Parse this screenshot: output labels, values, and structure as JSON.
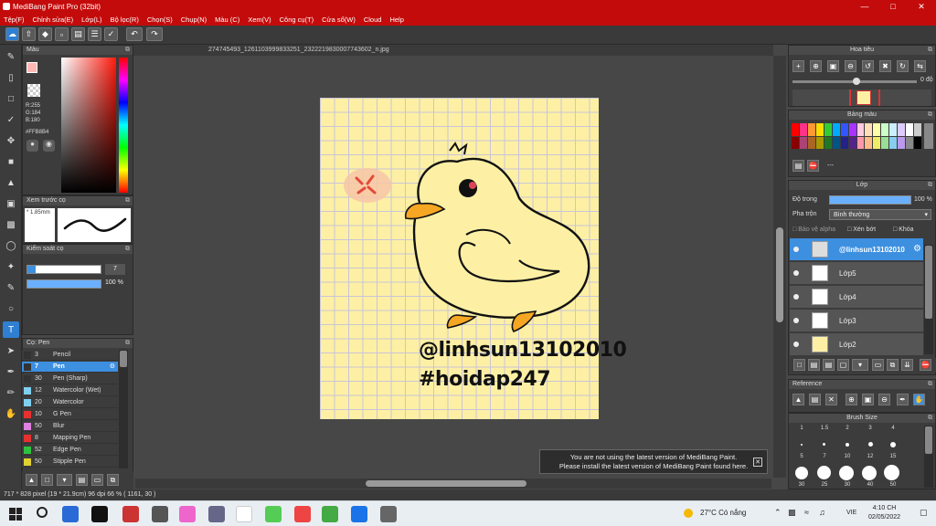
{
  "window": {
    "title": "MediBang Paint Pro (32bit)"
  },
  "menu": [
    "Tệp(F)",
    "Chỉnh sửa(E)",
    "Lớp(L)",
    "Bộ lọc(R)",
    "Chọn(S)",
    "Chụp(N)",
    "Màu (C)",
    "Xem(V)",
    "Công cụ(T)",
    "Cửa sổ(W)",
    "Cloud",
    "Help"
  ],
  "color_panel": {
    "title": "Màu",
    "r": "R:255",
    "g": "G:184",
    "b": "B:180",
    "hex": "#FFB8B4",
    "accent": "#ffb8b4"
  },
  "brush_preview": {
    "title": "Xem trước cọ",
    "size": "1.85mm"
  },
  "brush_control": {
    "title": "Kiểm soát cọ",
    "size": "7",
    "opacity": "100 %"
  },
  "brush_list": {
    "title": "Cọ: Pen",
    "items": [
      {
        "size": "3",
        "name": "Pencil",
        "color": "#333333"
      },
      {
        "size": "7",
        "name": "Pen",
        "color": "#333333"
      },
      {
        "size": "30",
        "name": "Pen (Sharp)",
        "color": "#333333"
      },
      {
        "size": "12",
        "name": "Watercolor (Wet)",
        "color": "#7fd0f0"
      },
      {
        "size": "20",
        "name": "Watercolor",
        "color": "#7fd0f0"
      },
      {
        "size": "10",
        "name": "G Pen",
        "color": "#e83030"
      },
      {
        "size": "50",
        "name": "Blur",
        "color": "#e080e0"
      },
      {
        "size": "8",
        "name": "Mapping Pen",
        "color": "#e83030"
      },
      {
        "size": "52",
        "name": "Edge Pen",
        "color": "#30c040"
      },
      {
        "size": "50",
        "name": "Stipple Pen",
        "color": "#e0d030"
      }
    ]
  },
  "document": {
    "tab": "274745493_1261103999833251_2322219830007743602_n.jpg",
    "text1": "@linhsun13102010",
    "text2": "#hoidap247"
  },
  "navigator": {
    "title": "Hoa tiêu",
    "angle": "0 độ"
  },
  "palette": {
    "title": "Bảng màu",
    "more": "---"
  },
  "layers": {
    "title": "Lớp",
    "opacity_label": "Độ trong",
    "opacity_value": "100 %",
    "blend_label": "Pha trộn",
    "blend_value": "Bình thường",
    "protect_alpha": "Bảo vệ alpha",
    "clipping": "Xén bớt",
    "lock": "Khóa",
    "items": [
      "@linhsun13102010",
      "Lớp5",
      "Lớp4",
      "Lớp3",
      "Lớp2"
    ]
  },
  "reference": {
    "title": "Reference"
  },
  "brush_size": {
    "title": "Brush Size",
    "row1": [
      "1",
      "1.5",
      "2",
      "3",
      "4"
    ],
    "row2": [
      "5",
      "7",
      "10",
      "12",
      "15"
    ],
    "row3": [
      "30",
      "25",
      "30",
      "40",
      "50"
    ]
  },
  "notification": {
    "line1": "You are not using the latest version of MediBang Paint.",
    "line2": "Please install the latest version of MediBang Paint found here."
  },
  "status": {
    "text": "717 * 828 pixel   (19 * 21.9cm)   96 dpi   66 %   ( 1161, 30 )"
  },
  "taskbar": {
    "weather": "27°C  Có nắng",
    "lang": "VIE",
    "time": "4:10 CH",
    "date": "02/05/2022"
  }
}
